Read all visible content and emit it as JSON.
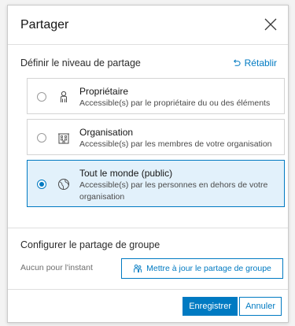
{
  "dialog": {
    "title": "Partager",
    "close_icon": "close-icon"
  },
  "level": {
    "label": "Définir le niveau de partage",
    "reset_label": "Rétablir",
    "options": [
      {
        "title": "Propriétaire",
        "description": "Accessible(s) par le propriétaire du ou des éléments",
        "icon": "user-icon",
        "selected": false
      },
      {
        "title": "Organisation",
        "description": "Accessible(s) par les membres de votre organisation",
        "icon": "organization-icon",
        "selected": false
      },
      {
        "title": "Tout le monde (public)",
        "description": "Accessible(s) par les personnes en dehors de votre organisation",
        "icon": "globe-icon",
        "selected": true
      }
    ]
  },
  "group": {
    "title": "Configurer le partage de groupe",
    "none_text": "Aucun pour l'instant",
    "update_button": "Mettre à jour le partage de groupe"
  },
  "footer": {
    "save_label": "Enregistrer",
    "cancel_label": "Annuler"
  },
  "colors": {
    "accent": "#007ac2",
    "selected_bg": "#e2f1fb"
  }
}
